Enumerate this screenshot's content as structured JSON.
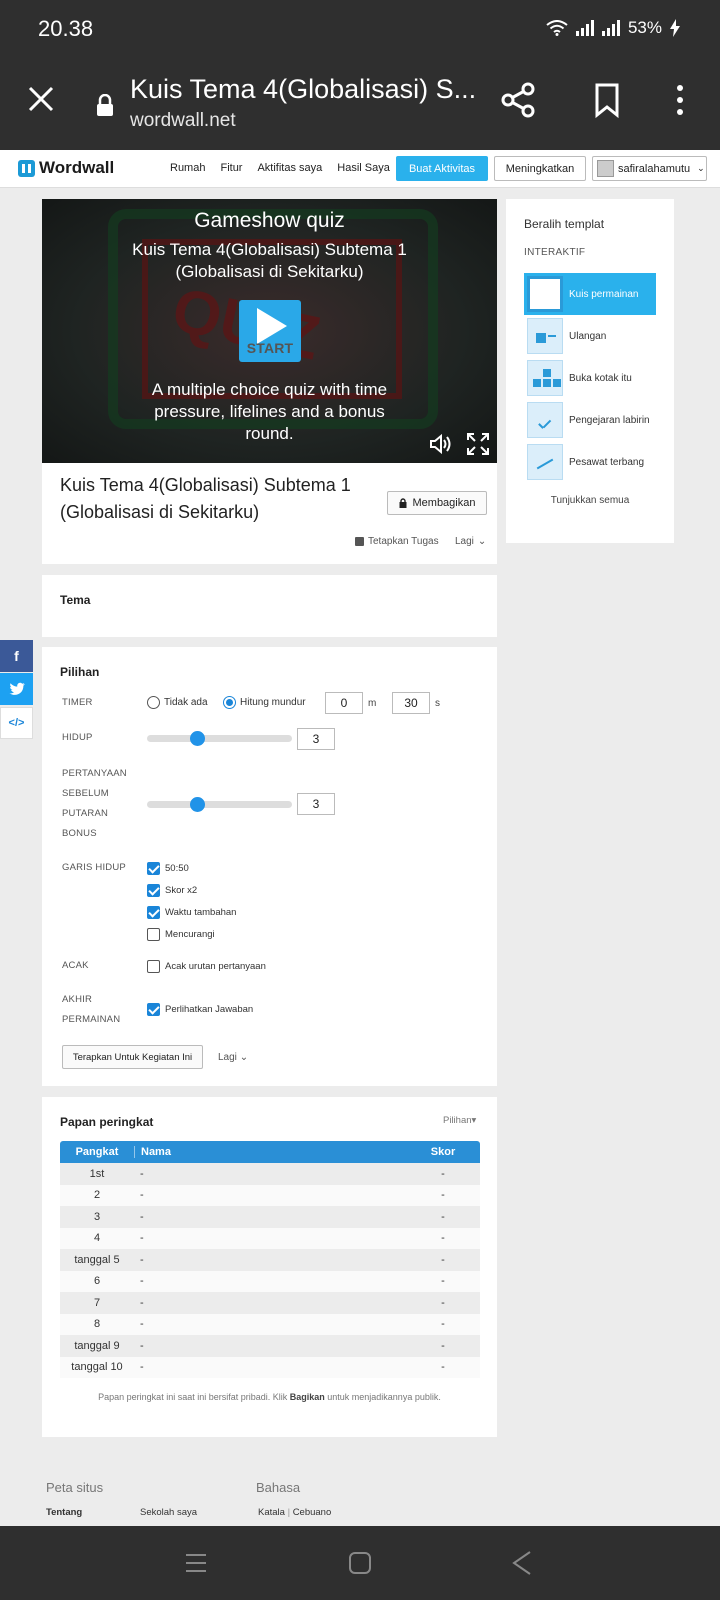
{
  "status": {
    "time": "20.38",
    "battery": "53%"
  },
  "browser": {
    "title": "Kuis Tema 4(Globalisasi) S...",
    "url": "wordwall.net"
  },
  "nav": {
    "logo": "Wordwall",
    "links": [
      "Rumah",
      "Fitur",
      "Aktifitas saya",
      "Hasil Saya"
    ],
    "create": "Buat Aktivitas",
    "upgrade": "Meningkatkan",
    "user": "safiralahamutu"
  },
  "game": {
    "template": "Gameshow quiz",
    "name": "Kuis Tema 4(Globalisasi) Subtema 1 (Globalisasi di Sekitarku)",
    "start": "START",
    "description": "A multiple choice quiz with time pressure, lifelines and a bonus round."
  },
  "activity": {
    "title": "Kuis Tema 4(Globalisasi) Subtema 1 (Globalisasi di Sekitarku)",
    "share": "Membagikan",
    "assign": "Tetapkan Tugas",
    "more": "Lagi"
  },
  "sidebar": {
    "title": "Beralih templat",
    "section": "INTERAKTIF",
    "items": [
      "Kuis permainan",
      "Ulangan",
      "Buka kotak itu",
      "Pengejaran labirin",
      "Pesawat terbang"
    ],
    "show_all": "Tunjukkan semua"
  },
  "tema": {
    "title": "Tema"
  },
  "options": {
    "title": "Pilihan",
    "timer_label": "TIMER",
    "timer_none": "Tidak ada",
    "timer_countdown": "Hitung mundur",
    "minutes": "0",
    "minutes_unit": "m",
    "seconds": "30",
    "seconds_unit": "s",
    "lives_label": "HIDUP",
    "lives": "3",
    "lives_level": 0.33,
    "bonus_label": [
      "PERTANYAAN",
      "SEBELUM",
      "PUTARAN",
      "BONUS"
    ],
    "bonus_value": "3",
    "bonus_level": 0.33,
    "lifelines_label": "GARIS HIDUP",
    "lifelines": [
      {
        "label": "50:50",
        "checked": true
      },
      {
        "label": "Skor x2",
        "checked": true
      },
      {
        "label": "Waktu tambahan",
        "checked": true
      },
      {
        "label": "Mencurangi",
        "checked": false
      }
    ],
    "random_label": "ACAK",
    "random_option": "Acak urutan pertanyaan",
    "end_label": [
      "AKHIR",
      "PERMAINAN"
    ],
    "end_option": "Perlihatkan Jawaban",
    "apply": "Terapkan Untuk Kegiatan Ini",
    "more": "Lagi"
  },
  "leaderboard": {
    "title": "Papan peringkat",
    "options": "Pilihan",
    "headers": [
      "Pangkat",
      "Nama",
      "Skor"
    ],
    "rows": [
      [
        "1st",
        "-",
        "-"
      ],
      [
        "2",
        "-",
        "-"
      ],
      [
        "3",
        "-",
        "-"
      ],
      [
        "4",
        "-",
        "-"
      ],
      [
        "tanggal 5",
        "-",
        "-"
      ],
      [
        "6",
        "-",
        "-"
      ],
      [
        "7",
        "-",
        "-"
      ],
      [
        "8",
        "-",
        "-"
      ],
      [
        "tanggal 9",
        "-",
        "-"
      ],
      [
        "tanggal 10",
        "-",
        "-"
      ]
    ],
    "note_pre": "Papan peringkat ini saat ini bersifat pribadi. Klik ",
    "note_bold": "Bagikan",
    "note_post": " untuk menjadikannya publik."
  },
  "footer": {
    "sitemap": "Peta situs",
    "language": "Bahasa",
    "about": "Tentang",
    "school": "Sekolah saya",
    "lang1": "Katala",
    "sep": "|",
    "lang2": "Cebuano"
  }
}
